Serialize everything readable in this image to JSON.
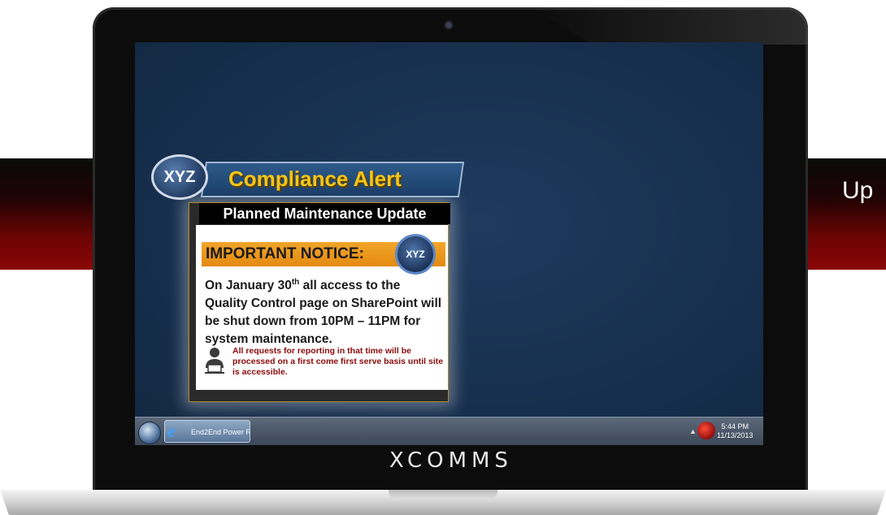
{
  "banner": {
    "right_text": "Up"
  },
  "alert": {
    "logo_text": "XYZ",
    "title": "Compliance Alert",
    "subheader": "Planned Maintenance Update",
    "notice_label": "IMPORTANT NOTICE:",
    "notice_logo_text": "XYZ",
    "body_pre": "On January 30",
    "body_sup": "th",
    "body_post": " all access to the Quality Control page on SharePoint will be shut down from 10PM – 11PM for system maintenance.",
    "footnote": "All requests for reporting in that time will be processed on a first come first serve basis until site is accessible."
  },
  "taskbar": {
    "task_label": "End2End Power R...",
    "time": "5:44 PM",
    "date": "11/13/2013"
  },
  "brand": "XCOMMS",
  "colors": {
    "screen": "#17304f",
    "title_gold": "#f5c518",
    "notice_orange": "#e38a12",
    "footnote_red": "#8b0a0a",
    "banner_red": "#8a0606"
  },
  "icons": [
    "start-orb-icon",
    "internet-explorer-icon",
    "tray-alert-icon",
    "user-at-laptop-icon",
    "xyz-logo-icon"
  ]
}
